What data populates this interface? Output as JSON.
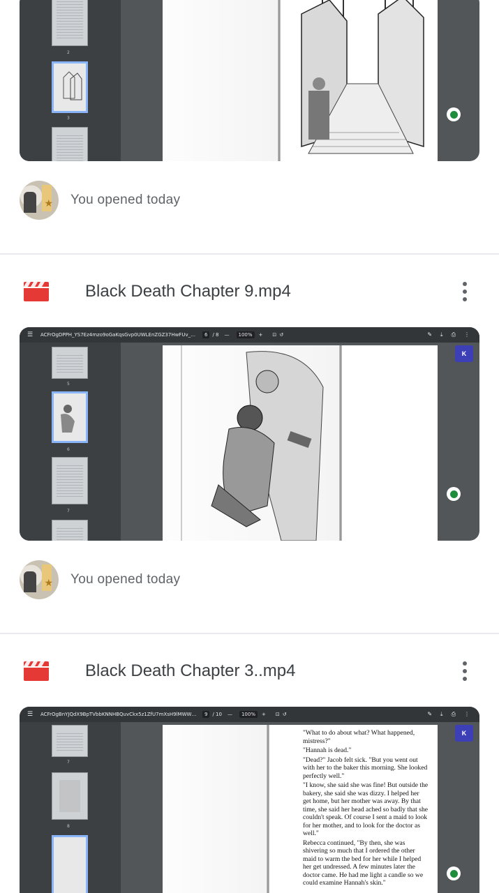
{
  "entries": [
    {
      "opened_text": "You opened today"
    },
    {
      "title": "Black Death Chapter 9.mp4",
      "pdf_filename": "ACFrOgDPPH_YS7Ez4mzo9oGaKqsGvp0UWLEnZGZ37HwFUv_Qca5a...",
      "page_current": "6",
      "page_total": "/ 8",
      "zoom": "100%",
      "thumb_numbers": [
        "5",
        "6",
        "7"
      ],
      "k_badge": "K",
      "opened_text": "You opened today"
    },
    {
      "title": "Black Death Chapter 3..mp4",
      "pdf_filename": "ACFrOgBnYJQdX9BpTVbbKNNHBQuvCkx5z1ZfU7mXsH9lMWWYSzx...",
      "page_current": "9",
      "page_total": "/ 10",
      "zoom": "100%",
      "thumb_numbers": [
        "7",
        "8"
      ],
      "k_badge": "K",
      "page_text": [
        "\"What to do about what? What happened, mistress?\"",
        "\"Hannah is dead.\"",
        "\"Dead?\" Jacob felt sick. \"But you went out with her to the baker this morning. She looked perfectly well.\"",
        "\"I know, she said she was fine! But outside the bakery, she said she was dizzy. I helped her get home, but her mother was away. By that time, she said her head ached so badly that she couldn't speak. Of course I sent a maid to look for her mother, and to look for the doctor as well.\"",
        "Rebecca continued, \"By then, she was shivering so much that I ordered the other maid to warm the bed for her while I helped her get undressed. A few minutes later the doctor came. He had me light a candle so we could examine Hannah's skin.\""
      ]
    }
  ],
  "top_thumb_number": "2",
  "top_thumb_number_b": "3",
  "colors": {
    "accent_red": "#e53935",
    "panel_dark": "#3c4043",
    "viewer_bg": "#525659",
    "thumb_active": "#8ab4f8"
  },
  "icons": {
    "video": "clapperboard-icon",
    "more": "kebab-menu-icon"
  }
}
